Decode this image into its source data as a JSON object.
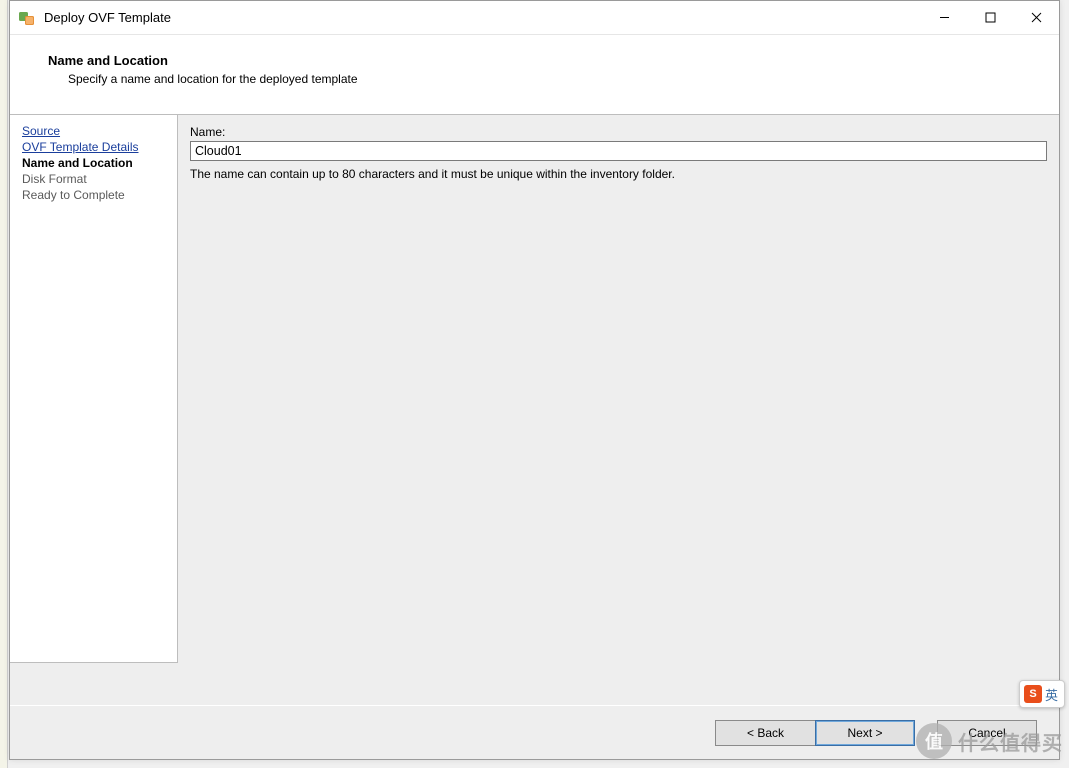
{
  "window": {
    "title": "Deploy OVF Template"
  },
  "header": {
    "title": "Name and Location",
    "description": "Specify a name and location for the deployed template"
  },
  "sidebar": {
    "items": [
      {
        "label": "Source",
        "style": "link",
        "interact": true
      },
      {
        "label": "OVF Template Details",
        "style": "link",
        "interact": true
      },
      {
        "label": "Name and Location",
        "style": "bold",
        "interact": true
      },
      {
        "label": "Disk Format",
        "style": "plain",
        "interact": false
      },
      {
        "label": "Ready to Complete",
        "style": "plain",
        "interact": false
      }
    ]
  },
  "form": {
    "name_label": "Name:",
    "name_value": "Cloud01",
    "help": "The name can contain up to 80 characters and it must be unique within the inventory folder."
  },
  "buttons": {
    "back": "< Back",
    "next": "Next >",
    "cancel": "Cancel"
  },
  "ime": {
    "lang": "英"
  },
  "watermark": {
    "text": "什么值得买",
    "badge": "值"
  }
}
